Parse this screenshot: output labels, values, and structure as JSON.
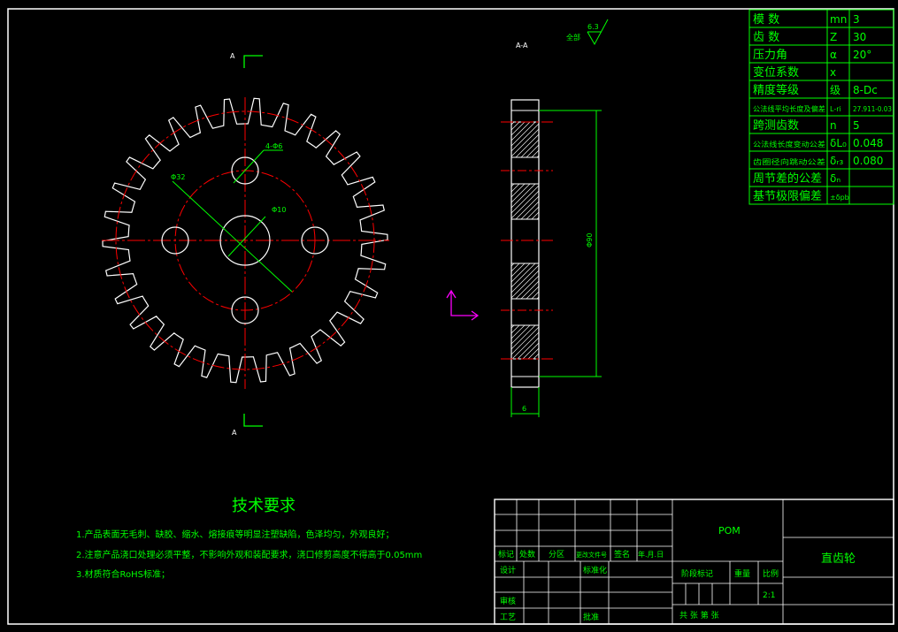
{
  "drawing": {
    "section_marker": "A",
    "section_title": "A-A",
    "roughness": {
      "value": "6.3",
      "label": "全部"
    },
    "dims": {
      "holes": "4-Φ6",
      "pcd": "Φ32",
      "bore": "Φ10",
      "tip_dia": "Φ90",
      "width": "6"
    }
  },
  "gear_table": [
    {
      "name": "模    数",
      "symbol": "mn",
      "value": "3"
    },
    {
      "name": "齿    数",
      "symbol": "Z",
      "value": "30"
    },
    {
      "name": "压力角",
      "symbol": "α",
      "value": "20°"
    },
    {
      "name": "变位系数",
      "symbol": "x",
      "value": ""
    },
    {
      "name": "精度等级",
      "symbol": "级",
      "value": "8-Dc"
    },
    {
      "name": "公法线平均长度及偏差",
      "symbol": "L-ri",
      "value": "27.911-0.03"
    },
    {
      "name": "跨测齿数",
      "symbol": "n",
      "value": "5"
    },
    {
      "name": "公法线长度变动公差",
      "symbol": "δL₀",
      "value": "0.048"
    },
    {
      "name": "齿圈径向跳动公差",
      "symbol": "δᵣ₃",
      "value": "0.080"
    },
    {
      "name": "周节差的公差",
      "symbol": "δₙ",
      "value": ""
    },
    {
      "name": "基节极限偏差",
      "symbol": "±δpb",
      "value": ""
    }
  ],
  "tech_req": {
    "title": "技术要求",
    "items": [
      "1.产品表面无毛刺、缺胶、缩水、熔接痕等明显注塑缺陷，色泽均匀，外观良好；",
      "2.注意产品浇口处理必须平整，不影响外观和装配要求，浇口修剪高度不得高于0.05mm",
      "3.材质符合RoHS标准；"
    ]
  },
  "title_block": {
    "material": "POM",
    "part_name": "直齿轮",
    "scale_label": "比例",
    "scale": "2:1",
    "weight_label": "重量",
    "stage_label": "阶段标记",
    "h_mark": "标记",
    "h_qty": "处数",
    "h_zone": "分区",
    "h_docno": "更改文件号",
    "h_sign": "签名",
    "h_date": "年.月.日",
    "design": "设计",
    "std": "标准化",
    "review": "审核",
    "process": "工艺",
    "approve": "批准",
    "total_sheets": "共    张  第    张"
  },
  "colors": {
    "bg": "#000000",
    "outline": "#ffffff",
    "center": "#ff0000",
    "dim": "#00ff00",
    "ucs": "#ff00ff",
    "hatch": "#ffffff"
  }
}
